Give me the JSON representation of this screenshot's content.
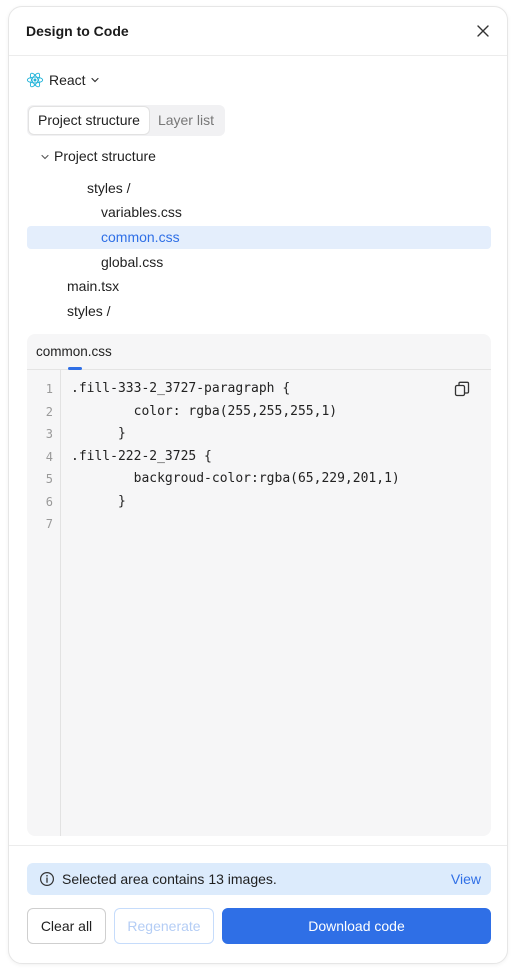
{
  "header": {
    "title": "Design to Code"
  },
  "framework": {
    "label": "React"
  },
  "tabs": [
    {
      "label": "Project structure",
      "active": true
    },
    {
      "label": "Layer list",
      "active": false
    }
  ],
  "tree": [
    {
      "label": "Project structure"
    },
    {
      "label": "styles /"
    },
    {
      "label": "variables.css"
    },
    {
      "label": "common.css"
    },
    {
      "label": "global.css"
    },
    {
      "label": "main.tsx"
    },
    {
      "label": "styles /"
    }
  ],
  "editor": {
    "file_tab": "common.css",
    "lines": [
      {
        "num": "1",
        "text": ".fill-333-2_3727-paragraph {"
      },
      {
        "num": "2",
        "text": "        color: rgba(255,255,255,1)"
      },
      {
        "num": "3",
        "text": "      }"
      },
      {
        "num": "4",
        "text": ".fill-222-2_3725 {"
      },
      {
        "num": "5",
        "text": "        backgroud-color:rgba(65,229,201,1)"
      },
      {
        "num": "6",
        "text": "      }"
      },
      {
        "num": "7",
        "text": ""
      }
    ]
  },
  "notice": {
    "text": "Selected area contains 13 images.",
    "link": "View"
  },
  "buttons": {
    "clear": "Clear all",
    "regenerate": "Regenerate",
    "download": "Download code"
  },
  "colors": {
    "accent": "#2f6fe6",
    "selected_bg": "#e4eefc",
    "notice_bg": "#dcebfc",
    "react": "#1fb3d9"
  },
  "icons": [
    "close-icon",
    "react-icon",
    "chevron-down-icon",
    "copy-icon",
    "info-icon"
  ]
}
